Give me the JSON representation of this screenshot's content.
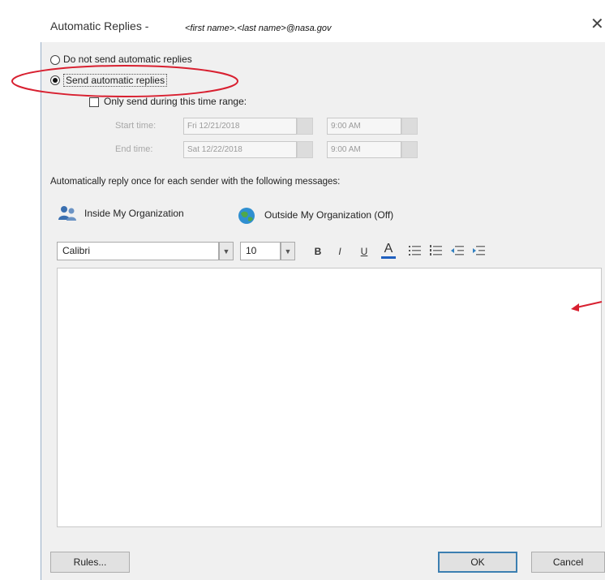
{
  "window": {
    "title": "Automatic Replies -",
    "account": "<first name>.<last name>@nasa.gov",
    "close_glyph": "✕"
  },
  "options": {
    "do_not_send_label": "Do not send automatic replies",
    "send_label": "Send automatic replies",
    "selected": "send"
  },
  "time_range": {
    "checkbox_label": "Only send during this time range:",
    "checked": false,
    "start_label": "Start time:",
    "start_date": "Fri 12/21/2018",
    "start_time": "9:00 AM",
    "end_label": "End time:",
    "end_date": "Sat 12/22/2018",
    "end_time": "9:00 AM"
  },
  "instructions": "Automatically reply once for each sender with the following messages:",
  "tabs": [
    {
      "label": "Inside My Organization",
      "icon": "people-icon",
      "active": true
    },
    {
      "label": "Outside My Organization (Off)",
      "icon": "globe-icon",
      "active": false
    }
  ],
  "toolbar": {
    "font": "Calibri",
    "size": "10",
    "bold": "B",
    "italic": "I",
    "underline": "U",
    "font_color": "A",
    "font_color_hex": "#1f5fbf"
  },
  "editor": {
    "text": ""
  },
  "buttons": {
    "rules": "Rules...",
    "ok": "OK",
    "cancel": "Cancel"
  },
  "colors": {
    "annotation": "#d82030",
    "dialog_bg": "#f0f0f0",
    "ok_border": "#3c7fb1"
  }
}
